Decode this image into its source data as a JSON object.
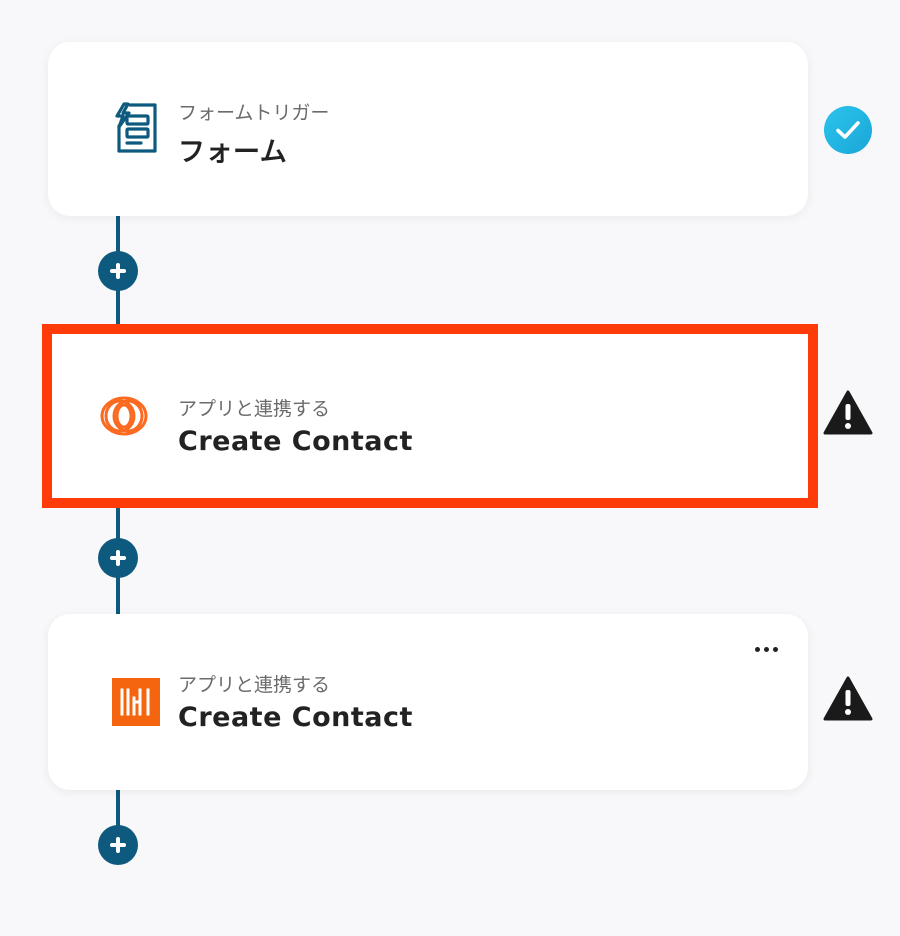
{
  "colors": {
    "background": "#f8f7fa",
    "connector": "#0e5a7e",
    "selection_outline": "#ff3b0a",
    "success": "#22b7e3",
    "warning": "#1a1a1a",
    "hubspot_orange": "#fa6b21",
    "brand_orange": "#f5650f"
  },
  "flow": {
    "steps": [
      {
        "subtitle": "フォームトリガー",
        "title": "フォーム",
        "icon": "form-trigger-icon",
        "status": "success-check-icon",
        "selected": false
      },
      {
        "subtitle": "アプリと連携する",
        "title": "Create Contact",
        "icon": "rings-logo-icon",
        "status": "warning-icon",
        "selected": true
      },
      {
        "subtitle": "アプリと連携する",
        "title": "Create Contact",
        "icon": "bars-logo-icon",
        "status": "warning-icon",
        "selected": false,
        "has_menu": true
      }
    ]
  }
}
